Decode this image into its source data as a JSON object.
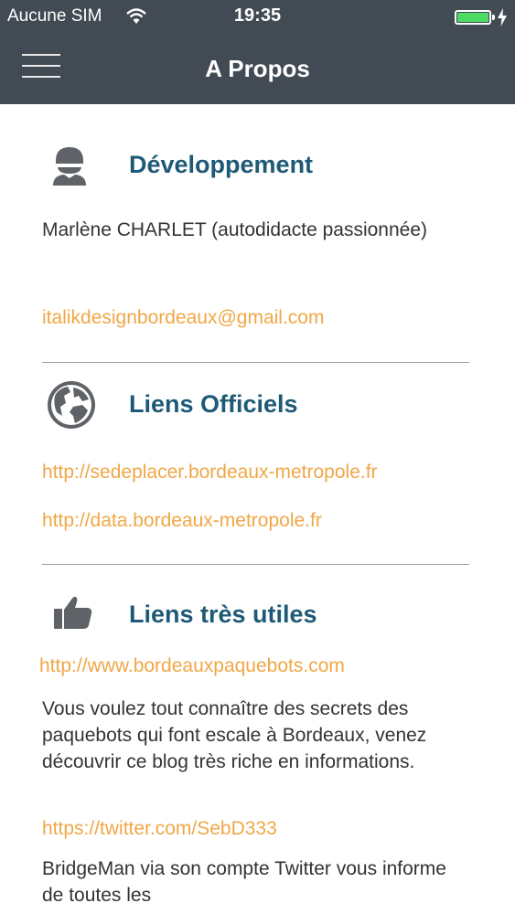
{
  "status_bar": {
    "carrier": "Aucune SIM",
    "time": "19:35",
    "battery_level": 1.0,
    "battery_color": "#4cd964"
  },
  "nav": {
    "title": "A Propos",
    "menu_icon": "hamburger-icon"
  },
  "sections": {
    "development": {
      "icon": "person-icon",
      "title": "Développement",
      "author": "Marlène CHARLET (autodidacte passionnée)",
      "email": "italikdesignbordeaux@gmail.com"
    },
    "official_links": {
      "icon": "globe-icon",
      "title": "Liens Officiels",
      "links": [
        "http://sedeplacer.bordeaux-metropole.fr",
        "http://data.bordeaux-metropole.fr"
      ]
    },
    "useful_links": {
      "icon": "thumbs-up-icon",
      "title": "Liens très utiles",
      "items": [
        {
          "url": "http://www.bordeauxpaquebots.com",
          "description": "Vous voulez tout connaître des secrets des paquebots qui font escale à Bordeaux, venez découvrir ce blog très riche en informations."
        },
        {
          "url": "https://twitter.com/SebD333",
          "description": "BridgeMan via son compte Twitter vous informe de toutes les"
        }
      ]
    }
  },
  "colors": {
    "bar_background": "#424a54",
    "heading": "#1e5a77",
    "link": "#f0a746",
    "body_text": "#333333"
  }
}
